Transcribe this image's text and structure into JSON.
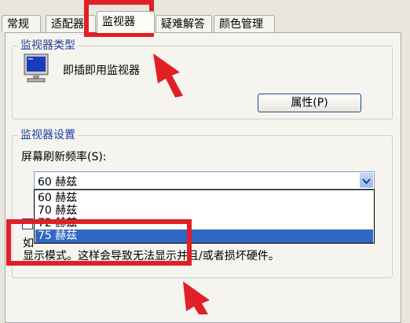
{
  "tabs": [
    {
      "label": "常规"
    },
    {
      "label": "适配器"
    },
    {
      "label": "监视器"
    },
    {
      "label": "疑难解答"
    },
    {
      "label": "颜色管理"
    }
  ],
  "monitor_type": {
    "title": "监视器类型",
    "name": "即插即用监视器",
    "properties_button": "属性(P)"
  },
  "monitor_settings": {
    "title": "监视器设置",
    "refresh_label": "屏幕刷新频率(S):",
    "selected_value": "60 赫兹",
    "options": [
      "60 赫兹",
      "70 赫兹",
      "72 赫兹",
      "75 赫兹"
    ],
    "highlighted_option": "75 赫兹",
    "warning_line1": "如",
    "warning_line2": "显示模式。这样会导致无法显示并且/或者损坏硬件。"
  },
  "colors": {
    "annotation_red": "#e01f26",
    "selection_blue": "#3168c5",
    "group_title_blue": "#1e3c9f"
  },
  "icons": {
    "monitor": "monitor-icon",
    "dropdown_arrow": "chevron-down-icon",
    "annotation_arrow": "arrow-annotation-icon"
  }
}
